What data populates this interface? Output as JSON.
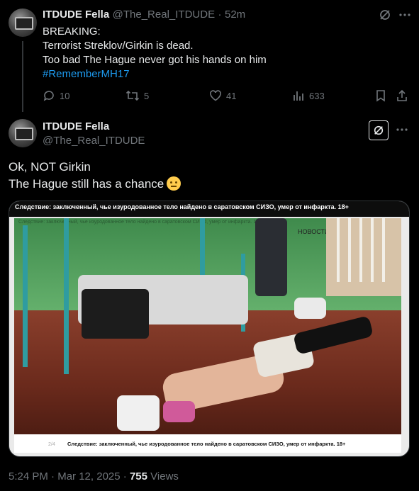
{
  "tweet1": {
    "display_name": "ITDUDE Fella",
    "handle": "@The_Real_ITDUDE",
    "separator": "·",
    "time": "52m",
    "lines": [
      "BREAKING:",
      "Terrorist Streklov/Girkin is dead.",
      "Too bad The Hague never got his hands on him"
    ],
    "hashtag": "#RememberMH17",
    "replies": "10",
    "reposts": "5",
    "likes": "41",
    "views": "633"
  },
  "tweet2": {
    "display_name": "ITDUDE Fella",
    "handle": "@The_Real_ITDUDE",
    "lines": [
      "Ok, NOT Girkin",
      "The Hague still has a chance"
    ],
    "media": {
      "caption_top": "Следствие: заключенный, чье изуродованное тело найдено в саратовском СИЗО, умер от инфаркта. 18+",
      "caption_ghost": "Следствие: заключенный, чье изуродованное тело найдено в саратовском СИЗО, умер от инфаркта. 18+",
      "news_tag": "НОВОСТИ",
      "page_num": "2/4",
      "caption_bottom": "Следствие: заключенный, чье изуродованное тело найдено в саратовском СИЗО, умер от инфаркта. 18+"
    },
    "time": "5:24 PM",
    "separator": "·",
    "date": "Mar 12, 2025",
    "separator2": "·",
    "views_count": "755",
    "views_label": "Views"
  },
  "icons": {
    "grok": "grok-icon",
    "more": "more-icon",
    "reply": "reply-icon",
    "repost": "repost-icon",
    "like": "like-icon",
    "analytics": "analytics-icon",
    "bookmark": "bookmark-icon",
    "share": "share-icon"
  },
  "colors": {
    "background": "#000000",
    "text": "#e7e9ea",
    "muted": "#71767b",
    "link": "#1d9bf0"
  }
}
